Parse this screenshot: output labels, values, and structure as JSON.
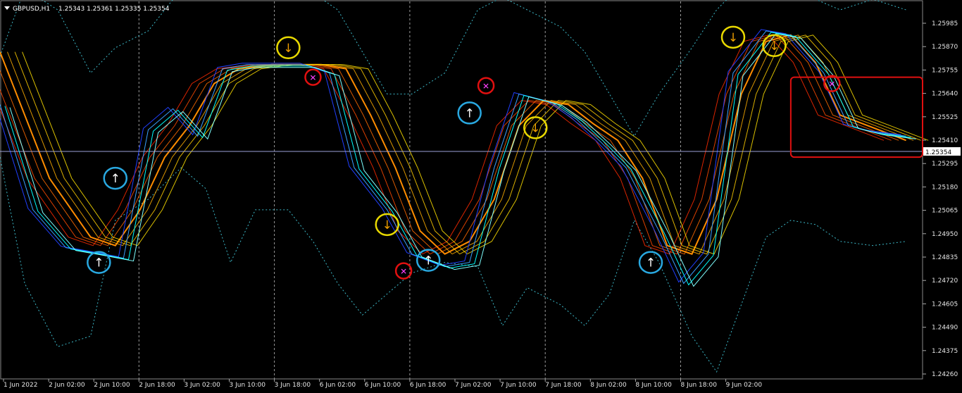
{
  "window": {
    "title": "GBPUSD,H1",
    "ohlc": "1.25343 1.25361 1.25335 1.25354"
  },
  "chart_data": {
    "type": "line",
    "symbol": "GBPUSD",
    "timeframe": "H1",
    "title": "GBPUSD,H1  1.25343 1.25361 1.25335 1.25354",
    "ylim": [
      1.2426,
      1.2602
    ],
    "y_ticks": [
      "1.25985",
      "1.25870",
      "1.25755",
      "1.25640",
      "1.25525",
      "1.25410",
      "1.25295",
      "1.25180",
      "1.25065",
      "1.24950",
      "1.24835",
      "1.24720",
      "1.24605",
      "1.24490",
      "1.24375",
      "1.24260"
    ],
    "x_ticks": [
      "1 Jun 2022",
      "2 Jun 02:00",
      "2 Jun 10:00",
      "2 Jun 18:00",
      "3 Jun 02:00",
      "3 Jun 10:00",
      "3 Jun 18:00",
      "6 Jun 02:00",
      "6 Jun 10:00",
      "6 Jun 18:00",
      "7 Jun 02:00",
      "7 Jun 10:00",
      "7 Jun 18:00",
      "8 Jun 02:00",
      "8 Jun 10:00",
      "8 Jun 18:00",
      "9 Jun 02:00"
    ],
    "current_price": "1.25354",
    "grid": true,
    "colors": {
      "background": "#000000",
      "grid": "#9a9a9a",
      "price": "#00ffff",
      "bands": "#3cb8c8",
      "ribbon_slow": "#ff3c00",
      "ribbon_fast": "#ffd400",
      "current_line": "#9aa0d8",
      "buy_marker": "#29a8e0",
      "sell_marker": "#e8d800",
      "exit_marker": "#e01010"
    },
    "series": [
      {
        "style": "price",
        "x": [
          0,
          4,
          8,
          11,
          15,
          18,
          21,
          24,
          27,
          30,
          34,
          37,
          40,
          43,
          47,
          50,
          54,
          57,
          60,
          63,
          67,
          70,
          73,
          76,
          80,
          83,
          86,
          89,
          93,
          96,
          100,
          103,
          106,
          110
        ],
        "y": [
          1.2555,
          1.2505,
          1.2487,
          1.2485,
          1.2482,
          1.2543,
          1.2553,
          1.254,
          1.2572,
          1.2574,
          1.2574,
          1.2574,
          1.257,
          1.2525,
          1.2505,
          1.2484,
          1.2478,
          1.248,
          1.2525,
          1.256,
          1.2556,
          1.2548,
          1.2537,
          1.2525,
          1.2495,
          1.247,
          1.2484,
          1.257,
          1.259,
          1.2588,
          1.257,
          1.2545,
          1.2542,
          1.254
        ]
      },
      {
        "style": "ribbon-mid",
        "x": [
          0,
          6,
          11,
          14,
          17,
          20,
          23,
          26,
          29,
          33,
          36,
          39,
          42,
          45,
          48,
          51,
          54,
          57,
          60,
          63,
          66,
          69,
          72,
          75,
          78,
          81,
          84,
          87,
          90,
          93,
          96,
          99,
          102,
          106,
          110
        ],
        "y": [
          1.258,
          1.252,
          1.2492,
          1.2488,
          1.2505,
          1.253,
          1.2545,
          1.2565,
          1.2572,
          1.2574,
          1.2574,
          1.2574,
          1.2572,
          1.255,
          1.2525,
          1.2495,
          1.2484,
          1.249,
          1.251,
          1.2545,
          1.2557,
          1.2555,
          1.2546,
          1.2538,
          1.252,
          1.2488,
          1.2484,
          1.251,
          1.256,
          1.2585,
          1.2588,
          1.2575,
          1.255,
          1.2544,
          1.2538
        ]
      },
      {
        "style": "upper-band",
        "x": [
          0,
          3,
          7,
          11,
          14,
          18,
          22,
          25,
          28,
          31,
          35,
          38,
          41,
          44,
          47,
          50,
          54,
          58,
          61,
          64,
          68,
          71,
          74,
          77,
          80,
          84,
          87,
          90,
          93,
          96,
          99,
          102,
          106,
          110
        ],
        "y": [
          1.2578,
          1.261,
          1.26,
          1.257,
          1.2582,
          1.259,
          1.261,
          1.261,
          1.2615,
          1.2615,
          1.261,
          1.2608,
          1.26,
          1.258,
          1.256,
          1.256,
          1.257,
          1.26,
          1.2606,
          1.26,
          1.2592,
          1.258,
          1.256,
          1.254,
          1.256,
          1.2582,
          1.26,
          1.2612,
          1.2615,
          1.2612,
          1.2605,
          1.26,
          1.2605,
          1.26
        ]
      },
      {
        "style": "lower-band",
        "x": [
          0,
          3,
          7,
          11,
          14,
          18,
          22,
          25,
          28,
          31,
          35,
          38,
          41,
          44,
          47,
          50,
          54,
          58,
          61,
          64,
          68,
          71,
          74,
          77,
          80,
          84,
          87,
          90,
          93,
          96,
          99,
          102,
          106,
          110
        ],
        "y": [
          1.253,
          1.247,
          1.244,
          1.2445,
          1.25,
          1.251,
          1.2525,
          1.2515,
          1.248,
          1.2505,
          1.2505,
          1.249,
          1.247,
          1.2455,
          1.2465,
          1.2475,
          1.248,
          1.2478,
          1.245,
          1.2468,
          1.246,
          1.245,
          1.2465,
          1.25,
          1.248,
          1.2445,
          1.2428,
          1.246,
          1.2492,
          1.25,
          1.2498,
          1.249,
          1.2488,
          1.249
        ]
      }
    ],
    "signals": [
      {
        "type": "buy",
        "x": 12,
        "y": 1.248,
        "label": "↑"
      },
      {
        "type": "buy",
        "x": 14,
        "y": 1.252,
        "label": "↑"
      },
      {
        "type": "sell",
        "x": 35,
        "y": 1.2582,
        "label": "↓"
      },
      {
        "type": "exit",
        "x": 38,
        "y": 1.2568,
        "label": ""
      },
      {
        "type": "sell",
        "x": 47,
        "y": 1.2498,
        "label": "↓"
      },
      {
        "type": "exit",
        "x": 49,
        "y": 1.2476,
        "label": ""
      },
      {
        "type": "buy",
        "x": 52,
        "y": 1.2481,
        "label": "↑"
      },
      {
        "type": "buy",
        "x": 57,
        "y": 1.2551,
        "label": "↑"
      },
      {
        "type": "exit",
        "x": 59,
        "y": 1.2564,
        "label": ""
      },
      {
        "type": "sell",
        "x": 65,
        "y": 1.2544,
        "label": "↓"
      },
      {
        "type": "buy",
        "x": 79,
        "y": 1.248,
        "label": "↑"
      },
      {
        "type": "sell",
        "x": 89,
        "y": 1.2587,
        "label": "↓"
      },
      {
        "type": "sell",
        "x": 94,
        "y": 1.2583,
        "label": "↓"
      },
      {
        "type": "exit",
        "x": 101,
        "y": 1.2565,
        "label": ""
      }
    ],
    "highlight_box": {
      "x0": 96,
      "x1": 112,
      "y0": 1.253,
      "y1": 1.2568
    }
  }
}
